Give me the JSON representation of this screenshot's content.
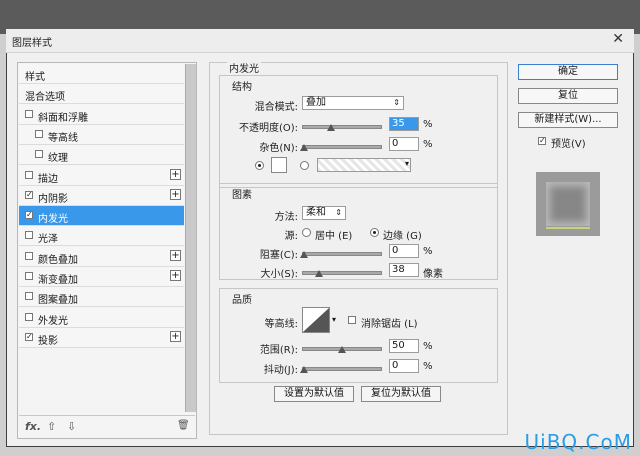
{
  "window": {
    "title": "图层样式",
    "close_glyph": "✕"
  },
  "left": {
    "items": [
      {
        "label": "样式",
        "checkbox": null,
        "checked": false,
        "plus": false,
        "indent": 0,
        "selected": false
      },
      {
        "label": "混合选项",
        "checkbox": null,
        "checked": false,
        "plus": false,
        "indent": 0,
        "selected": false
      },
      {
        "label": "斜面和浮雕",
        "checkbox": true,
        "checked": false,
        "plus": false,
        "indent": 0,
        "selected": false
      },
      {
        "label": "等高线",
        "checkbox": true,
        "checked": false,
        "plus": false,
        "indent": 1,
        "selected": false
      },
      {
        "label": "纹理",
        "checkbox": true,
        "checked": false,
        "plus": false,
        "indent": 1,
        "selected": false
      },
      {
        "label": "描边",
        "checkbox": true,
        "checked": false,
        "plus": true,
        "indent": 0,
        "selected": false
      },
      {
        "label": "内阴影",
        "checkbox": true,
        "checked": true,
        "plus": true,
        "indent": 0,
        "selected": false
      },
      {
        "label": "内发光",
        "checkbox": true,
        "checked": true,
        "plus": false,
        "indent": 0,
        "selected": true
      },
      {
        "label": "光泽",
        "checkbox": true,
        "checked": false,
        "plus": false,
        "indent": 0,
        "selected": false
      },
      {
        "label": "颜色叠加",
        "checkbox": true,
        "checked": false,
        "plus": true,
        "indent": 0,
        "selected": false
      },
      {
        "label": "渐变叠加",
        "checkbox": true,
        "checked": false,
        "plus": true,
        "indent": 0,
        "selected": false
      },
      {
        "label": "图案叠加",
        "checkbox": true,
        "checked": false,
        "plus": false,
        "indent": 0,
        "selected": false
      },
      {
        "label": "外发光",
        "checkbox": true,
        "checked": false,
        "plus": false,
        "indent": 0,
        "selected": false
      },
      {
        "label": "投影",
        "checkbox": true,
        "checked": true,
        "plus": true,
        "indent": 0,
        "selected": false
      }
    ],
    "footer": {
      "fx": "fx.",
      "up": "⇧",
      "down": "⇩",
      "trash": "🗑"
    }
  },
  "main": {
    "section_title": "内发光",
    "structure": {
      "title": "结构",
      "blend_label": "混合模式:",
      "blend_value": "叠加",
      "opacity_label": "不透明度(O):",
      "opacity_value": "35",
      "noise_label": "杂色(N):",
      "noise_value": "0",
      "percent": "%"
    },
    "elements": {
      "title": "图素",
      "method_label": "方法:",
      "method_value": "柔和",
      "source_label": "源:",
      "source_center": "居中 (E)",
      "source_edge": "边缘 (G)",
      "choke_label": "阻塞(C):",
      "choke_value": "0",
      "size_label": "大小(S):",
      "size_value": "38",
      "size_unit": "像素",
      "percent": "%"
    },
    "quality": {
      "title": "品质",
      "contour_label": "等高线:",
      "antialias_label": "消除锯齿 (L)",
      "range_label": "范围(R):",
      "range_value": "50",
      "jitter_label": "抖动(J):",
      "jitter_value": "0",
      "percent": "%"
    },
    "buttons": {
      "set_default": "设置为默认值",
      "reset_default": "复位为默认值"
    }
  },
  "right": {
    "ok": "确定",
    "reset": "复位",
    "new_style": "新建样式(W)...",
    "preview_label": "预览(V)",
    "preview_checked": true
  },
  "watermark": "UiBQ.CoM",
  "colors": {
    "selected_row": "#3a98ea",
    "watermark": "#2a9de6"
  }
}
